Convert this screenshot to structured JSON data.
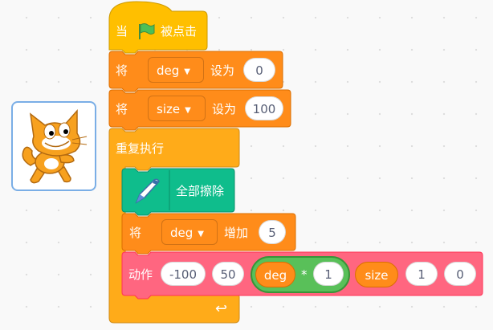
{
  "sprite": {
    "name_icon": "scratch-cat-icon"
  },
  "hat_block": {
    "prefix": "当",
    "suffix": "被点击",
    "flag_icon": "green-flag-icon"
  },
  "set_deg_block": {
    "verb": "将",
    "variable": "deg",
    "action": "设为",
    "value": "0"
  },
  "set_size_block": {
    "verb": "将",
    "variable": "size",
    "action": "设为",
    "value": "100"
  },
  "repeat_block": {
    "label": "重复执行",
    "loop_icon": "loop-arrow-icon"
  },
  "erase_block": {
    "label": "全部擦除",
    "pen_icon": "pen-icon"
  },
  "change_deg_block": {
    "verb": "将",
    "variable": "deg",
    "action": "增加",
    "value": "5"
  },
  "motion_block": {
    "label": "动作",
    "arg1": "-100",
    "arg2": "50",
    "multiply": {
      "left": "deg",
      "operator": "*",
      "right": "1"
    },
    "size_reporter": "size",
    "arg5": "1",
    "arg6": "0"
  },
  "colors": {
    "events": "#ffbf00",
    "control": "#ffab19",
    "variables": "#ff8c1a",
    "pen": "#0fbd8c",
    "operators": "#59c059",
    "custom": "#ff6680"
  }
}
